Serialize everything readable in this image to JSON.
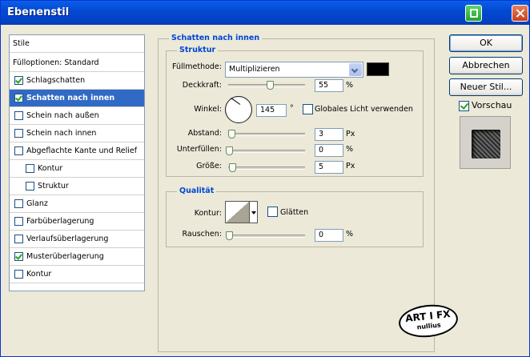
{
  "window": {
    "title": "Ebenenstil"
  },
  "sidebar": {
    "header": "Stile",
    "items": [
      {
        "label": "Fülloptionen: Standard",
        "checkbox": false
      },
      {
        "label": "Schlagschatten",
        "checkbox": true,
        "checked": true
      },
      {
        "label": "Schatten nach innen",
        "checkbox": true,
        "checked": true,
        "selected": true
      },
      {
        "label": "Schein nach außen",
        "checkbox": true,
        "checked": false
      },
      {
        "label": "Schein nach innen",
        "checkbox": true,
        "checked": false
      },
      {
        "label": "Abgeflachte Kante und Relief",
        "checkbox": true,
        "checked": false
      },
      {
        "label": "Kontur",
        "checkbox": true,
        "checked": false,
        "indent": true
      },
      {
        "label": "Struktur",
        "checkbox": true,
        "checked": false,
        "indent": true
      },
      {
        "label": "Glanz",
        "checkbox": true,
        "checked": false
      },
      {
        "label": "Farbüberlagerung",
        "checkbox": true,
        "checked": false
      },
      {
        "label": "Verlaufsüberlagerung",
        "checkbox": true,
        "checked": false
      },
      {
        "label": "Musterüberlagerung",
        "checkbox": true,
        "checked": true
      },
      {
        "label": "Kontur",
        "checkbox": true,
        "checked": false
      }
    ]
  },
  "panel": {
    "title": "Schatten nach innen",
    "struktur": {
      "title": "Struktur",
      "fuellmethode_label": "Füllmethode:",
      "fuellmethode_value": "Multiplizieren",
      "color": "#000000",
      "deckkraft_label": "Deckkraft:",
      "deckkraft_value": "55",
      "deckkraft_unit": "%",
      "winkel_label": "Winkel:",
      "winkel_value": "145",
      "winkel_unit": "°",
      "global_light_label": "Globales Licht verwenden",
      "abstand_label": "Abstand:",
      "abstand_value": "3",
      "abstand_unit": "Px",
      "unterfuellen_label": "Unterfüllen:",
      "unterfuellen_value": "0",
      "unterfuellen_unit": "%",
      "groesse_label": "Größe:",
      "groesse_value": "5",
      "groesse_unit": "Px"
    },
    "qualitaet": {
      "title": "Qualität",
      "kontur_label": "Kontur:",
      "glaetten_label": "Glätten",
      "rauschen_label": "Rauschen:",
      "rauschen_value": "0",
      "rauschen_unit": "%"
    }
  },
  "buttons": {
    "ok": "OK",
    "cancel": "Abbrechen",
    "new_style": "Neuer Stil...",
    "preview_label": "Vorschau"
  },
  "watermark": {
    "text": "ART I FX",
    "sub": "nullius"
  }
}
